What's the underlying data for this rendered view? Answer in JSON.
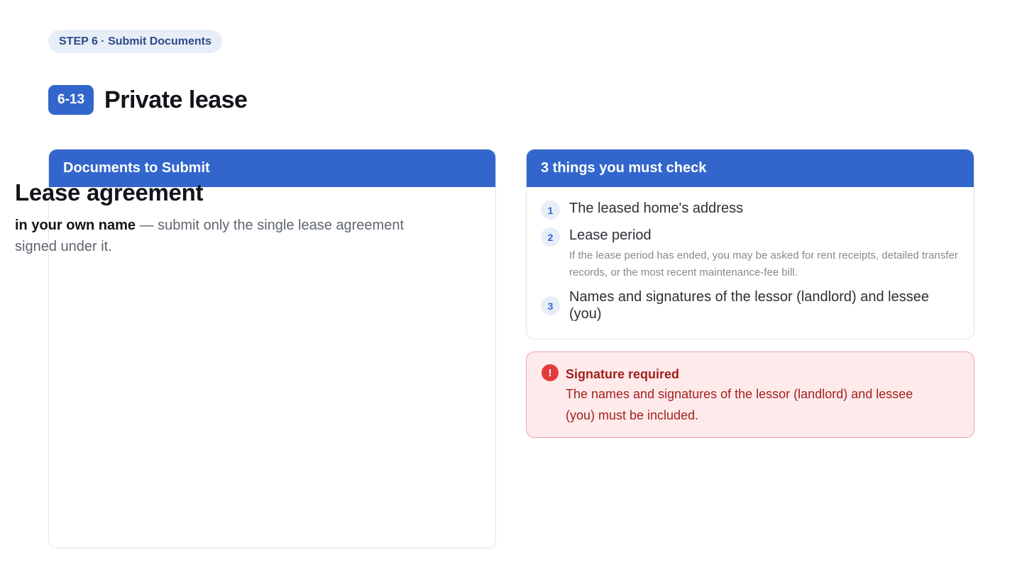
{
  "step": {
    "label": "STEP 6 · Submit Documents"
  },
  "heading": {
    "code": "6-13",
    "title": "Private lease"
  },
  "documents_card": {
    "header": "Documents to Submit",
    "doc_title": "Lease agreement",
    "doc_emphasis": "in your own name",
    "doc_rest": " — submit only the single lease agreement signed under it."
  },
  "checks_card": {
    "header": "3 things you must check",
    "items": [
      {
        "num": "1",
        "text": "The leased home's address"
      },
      {
        "num": "2",
        "text": "Lease period",
        "sub": "If the lease period has ended, you may be asked for rent receipts, detailed transfer records, or the most recent maintenance-fee bill."
      },
      {
        "num": "3",
        "text": "Names and signatures of the lessor (landlord) and lessee (you)"
      }
    ]
  },
  "alert": {
    "icon": "!",
    "icon_name": "exclamation-circle-icon",
    "title": "Signature required",
    "text": "The names and signatures of the lessor (landlord) and lessee (you) must be included."
  },
  "colors": {
    "accent": "#3366cc",
    "pill_bg": "#e8eef8",
    "alert_bg": "#feeaea",
    "alert_text": "#a3201f",
    "alert_icon": "#e23b3b"
  }
}
